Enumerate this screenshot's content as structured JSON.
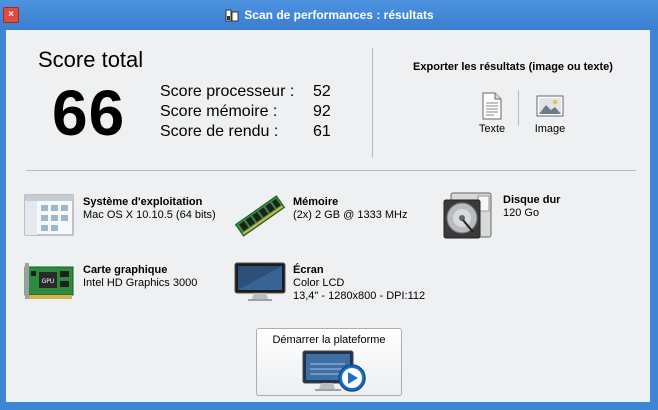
{
  "window": {
    "title": "Scan de performances : résultats",
    "close_label": "×"
  },
  "score": {
    "title": "Score total",
    "total": "66",
    "rows": [
      {
        "label": "Score processeur :",
        "value": "52"
      },
      {
        "label": "Score mémoire :",
        "value": "92"
      },
      {
        "label": "Score de rendu :",
        "value": "61"
      }
    ]
  },
  "export": {
    "title": "Exporter les résultats (image ou texte)",
    "text_label": "Texte",
    "image_label": "Image"
  },
  "specs": {
    "os": {
      "heading": "Système d'exploitation",
      "value": "Mac OS X 10.10.5 (64 bits)"
    },
    "memory": {
      "heading": "Mémoire",
      "value": "(2x) 2 GB @ 1333 MHz"
    },
    "disk": {
      "heading": "Disque dur",
      "value": "120 Go"
    },
    "gpu": {
      "heading": "Carte graphique",
      "value": "Intel HD Graphics 3000",
      "chip_label": "GPU"
    },
    "screen": {
      "heading": "Écran",
      "line1": "Color LCD",
      "line2": "13,4\" - 1280x800 - DPI:112"
    }
  },
  "start": {
    "label": "Démarrer la plateforme"
  }
}
